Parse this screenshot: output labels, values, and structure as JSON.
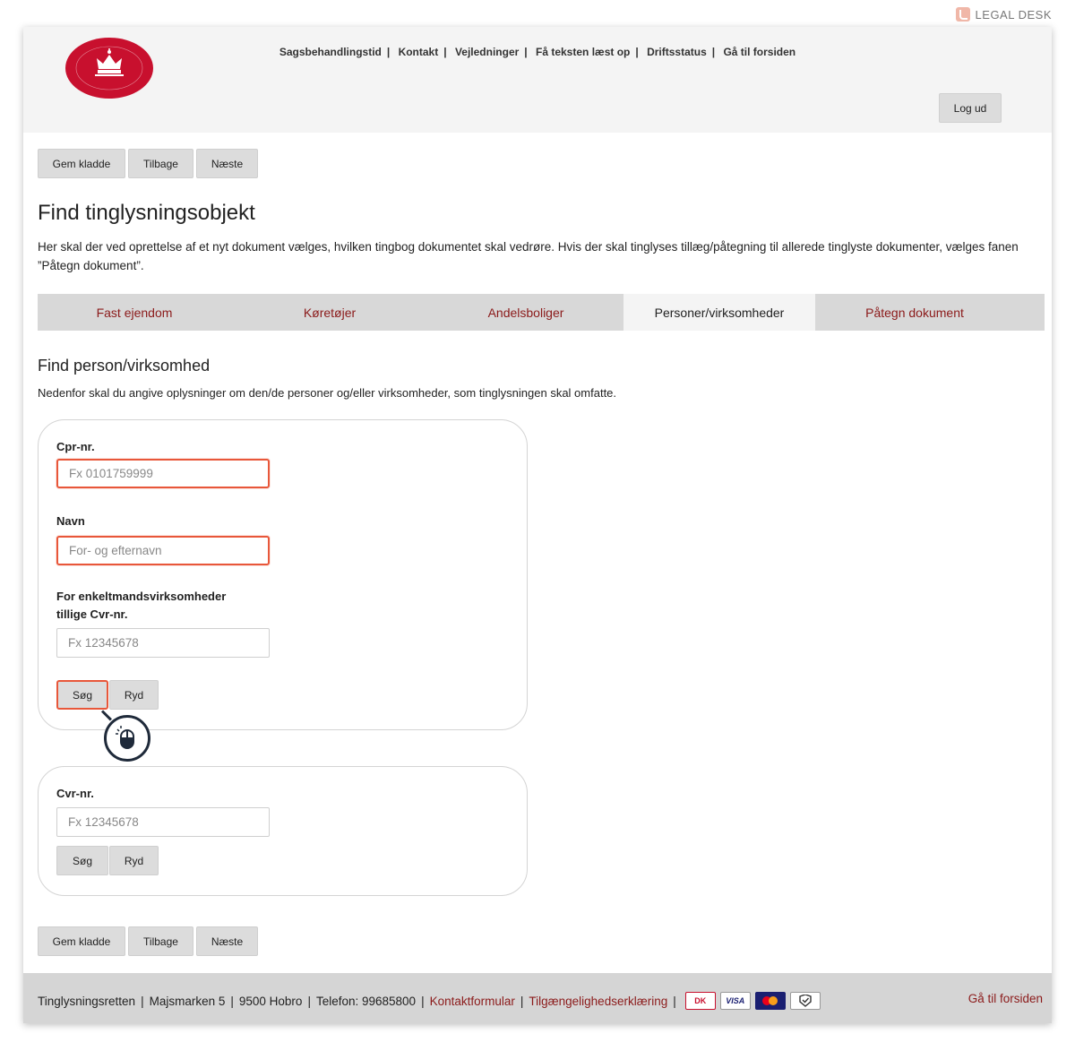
{
  "brand": {
    "name": "LEGAL DESK"
  },
  "colors": {
    "accent_red": "#8b1a1a",
    "highlight_orange": "#e8573a",
    "logo_red": "#c8102e"
  },
  "header": {
    "logo_icon": "crown-seal-icon",
    "nav": [
      "Sagsbehandlingstid",
      "Kontakt",
      "Vejledninger",
      "Få teksten læst op",
      "Driftsstatus",
      "Gå til forsiden"
    ],
    "nav_separator": "|",
    "logout_label": "Log ud"
  },
  "actions": {
    "save_draft": "Gem kladde",
    "back": "Tilbage",
    "next": "Næste"
  },
  "page": {
    "title": "Find tinglysningsobjekt",
    "intro": "Her skal der ved oprettelse af et nyt dokument vælges, hvilken tingbog dokumentet skal vedrøre. Hvis der skal tinglyses tillæg/påtegning til allerede tinglyste dokumenter, vælges fanen ”Påtegn dokument”."
  },
  "tabs": [
    {
      "label": "Fast ejendom",
      "active": false
    },
    {
      "label": "Køretøjer",
      "active": false
    },
    {
      "label": "Andelsboliger",
      "active": false
    },
    {
      "label": "Personer/virksomheder",
      "active": true
    },
    {
      "label": "Påtegn dokument",
      "active": false
    }
  ],
  "section": {
    "title": "Find person/virksomhed",
    "intro": "Nedenfor skal du angive oplysninger om den/de personer og/eller virksomheder, som tinglysningen skal omfatte."
  },
  "person_form": {
    "cpr_label": "Cpr-nr.",
    "cpr_placeholder": "Fx 0101759999",
    "name_label": "Navn",
    "name_placeholder": "For- og efternavn",
    "cvr_label_line1": "For enkeltmandsvirksomheder",
    "cvr_label_line2": "tillige Cvr-nr.",
    "cvr_placeholder": "Fx 12345678",
    "search_label": "Søg",
    "clear_label": "Ryd"
  },
  "company_form": {
    "cvr_label": "Cvr-nr.",
    "cvr_placeholder": "Fx 12345678",
    "search_label": "Søg",
    "clear_label": "Ryd"
  },
  "footer": {
    "org": "Tinglysningsretten",
    "address": "Majsmarken 5",
    "city": "9500 Hobro",
    "phone": "Telefon: 99685800",
    "contact_link": "Kontaktformular",
    "accessibility_link": "Tilgængelighedserklæring",
    "cards": {
      "dk": "DK",
      "visa": "VISA"
    },
    "home_link": "Gå til forsiden"
  }
}
